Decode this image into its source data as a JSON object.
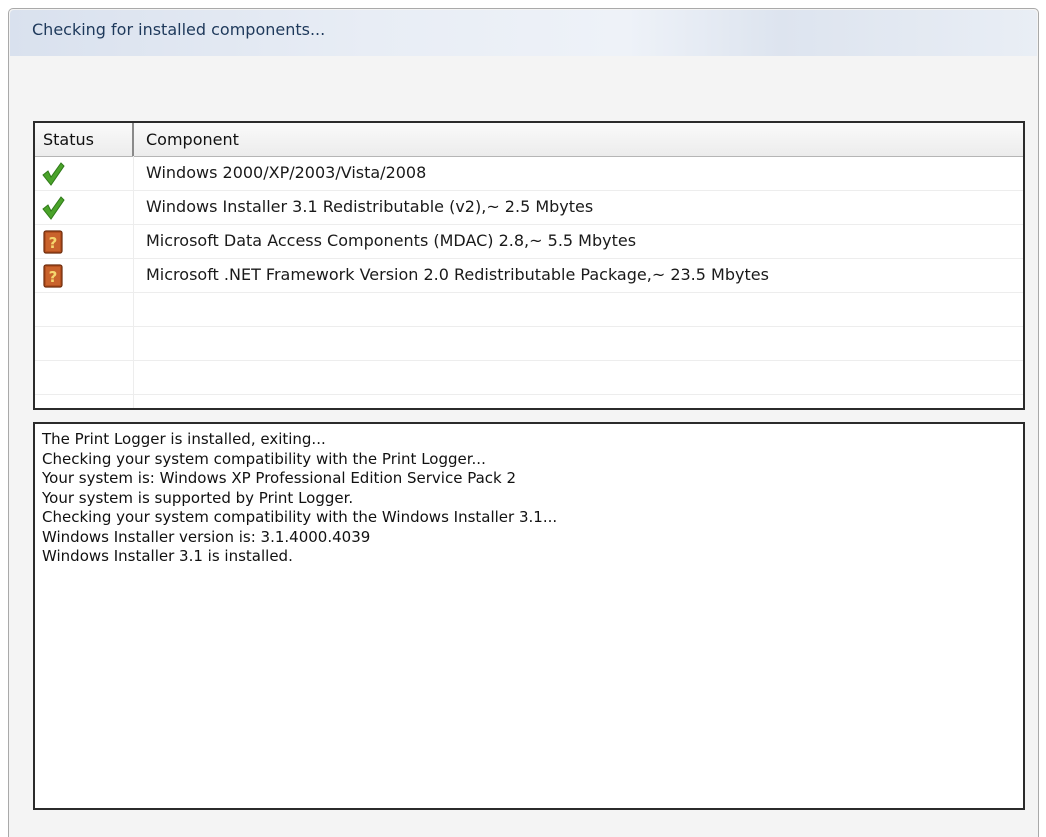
{
  "title": "Checking for installed components...",
  "table": {
    "columns": {
      "status": "Status",
      "component": "Component"
    },
    "rows": [
      {
        "status": "installed",
        "status_icon": "checkmark-icon",
        "component": "Windows 2000/XP/2003/Vista/2008"
      },
      {
        "status": "installed",
        "status_icon": "checkmark-icon",
        "component": "Windows Installer 3.1 Redistributable (v2),~ 2.5 Mbytes"
      },
      {
        "status": "unknown",
        "status_icon": "question-book-icon",
        "component": "Microsoft Data Access Components (MDAC) 2.8,~ 5.5 Mbytes"
      },
      {
        "status": "unknown",
        "status_icon": "question-book-icon",
        "component": "Microsoft .NET Framework Version 2.0 Redistributable Package,~ 23.5 Mbytes"
      }
    ]
  },
  "log": [
    "The Print Logger is installed, exiting...",
    "Checking your system compatibility with the Print Logger...",
    "Your system is: Windows XP Professional Edition Service Pack 2",
    "Your system is supported by Print Logger.",
    "Checking your system compatibility with the Windows Installer 3.1...",
    "Windows Installer version is: 3.1.4000.4039",
    "Windows Installer 3.1 is installed."
  ],
  "colors": {
    "check_green": "#4aa32a",
    "question_brown": "#b5501f",
    "title_text": "#1e395b"
  }
}
